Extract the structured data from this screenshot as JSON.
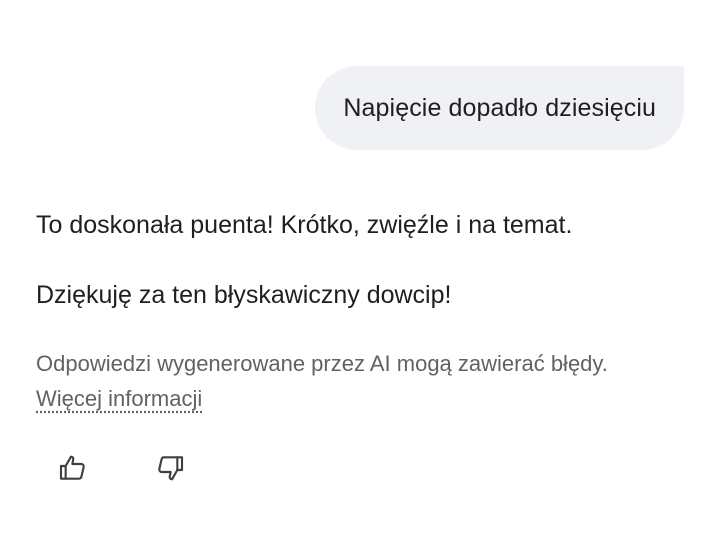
{
  "user_message": "Napięcie dopadło dziesięciu",
  "response": {
    "paragraphs": [
      "To doskonała puenta! Krótko, zwięźle i na temat.",
      "Dziękuję za ten błyskawiczny dowcip!"
    ]
  },
  "disclaimer": {
    "text": "Odpowiedzi wygenerowane przez AI mogą zawierać błędy.",
    "link": "Więcej informacji"
  },
  "feedback": {
    "thumbs_up_icon": "thumbs-up-icon",
    "thumbs_down_icon": "thumbs-down-icon"
  }
}
